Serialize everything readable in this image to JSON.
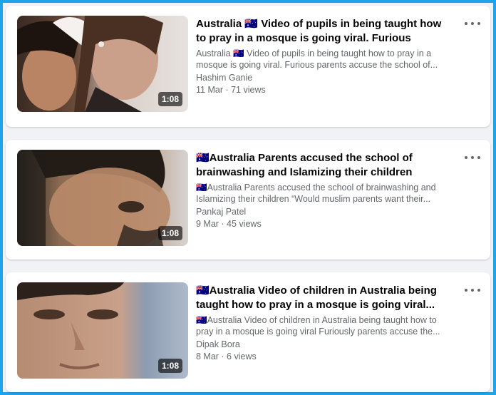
{
  "accent_color": "#1fa3ea",
  "videos": [
    {
      "title": "Australia 🇦🇺 Video of pupils in being taught how to pray in a mosque is going viral. Furious parents...",
      "description": "Australia 🇦🇺 Video of pupils in being taught how to pray in a mosque is going viral. Furious parents accuse the school of...",
      "author": "Hashim Ganie",
      "meta": "11 Mar · 71 views",
      "duration": "1:08"
    },
    {
      "title": "🇦🇺Australia Parents accused the school of brainwashing and Islamizing their children “Would...",
      "description": "🇦🇺Australia Parents accused the school of brainwashing and Islamizing their children “Would muslim parents want their...",
      "author": "Pankaj Patel",
      "meta": "9 Mar · 45 views",
      "duration": "1:08"
    },
    {
      "title": "🇦🇺Australia Video of children in Australia being taught how to pray in a mosque is going viral...",
      "description": "🇦🇺Australia Video of children in Australia being taught how to pray in a mosque is going viral Furiously parents accuse the...",
      "author": "Dipak Bora",
      "meta": "8 Mar · 6 views",
      "duration": "1:08"
    }
  ],
  "icons": {
    "more": "more-options-icon"
  }
}
